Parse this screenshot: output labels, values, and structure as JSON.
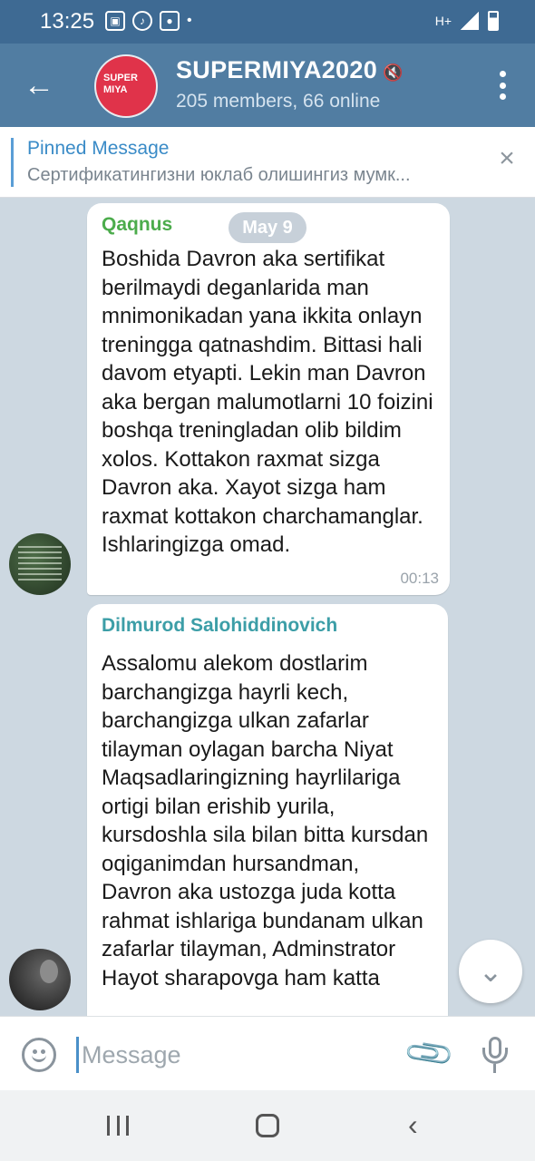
{
  "status_bar": {
    "time": "13:25",
    "icons": [
      "image-icon",
      "tiktok-icon",
      "media-icon"
    ],
    "network": "H+"
  },
  "header": {
    "title": "SUPERMIYA2020",
    "subtitle": "205 members, 66 online",
    "avatar_text": "SUPER MIYA"
  },
  "pinned": {
    "title": "Pinned Message",
    "text": "Сертификатингизни юклаб олишингиз мумк..."
  },
  "messages": [
    {
      "sender": "Qaqnus",
      "date_badge": "May 9",
      "text": "Boshida Davron aka sertifikat berilmaydi deganlarida man mnimonikadan yana ikkita onlayn treningga qatnashdim. Bittasi hali davom etyapti. Lekin man Davron aka bergan malumotlarni 10 foizini boshqa treningladan olib bildim xolos. Kottakon raxmat sizga Davron aka. Xayot sizga ham raxmat kottakon charchamanglar. Ishlaringizga omad.",
      "time": "00:13"
    },
    {
      "sender": "Dilmurod Salohiddinovich",
      "text": "Assalomu alekom dostlarim barchangizga hayrli kech, barchangizga ulkan zafarlar tilayman oylagan barcha Niyat Maqsadlaringizning hayrlilariga ortigi bilan erishib yurila, kursdoshla sila bilan bitta kursdan oqiganimdan hursandman, Davron aka ustozga juda kotta rahmat ishlariga bundanam ulkan zafarlar tilayman, Adminstrator Hayot sharapovga ham katta"
    }
  ],
  "composer": {
    "placeholder": "Message"
  },
  "colors": {
    "header": "#517da2",
    "status_bar": "#3e6a93",
    "sender1": "#4cac4c",
    "sender2": "#3c9ea7",
    "accent": "#3a8bc7"
  }
}
